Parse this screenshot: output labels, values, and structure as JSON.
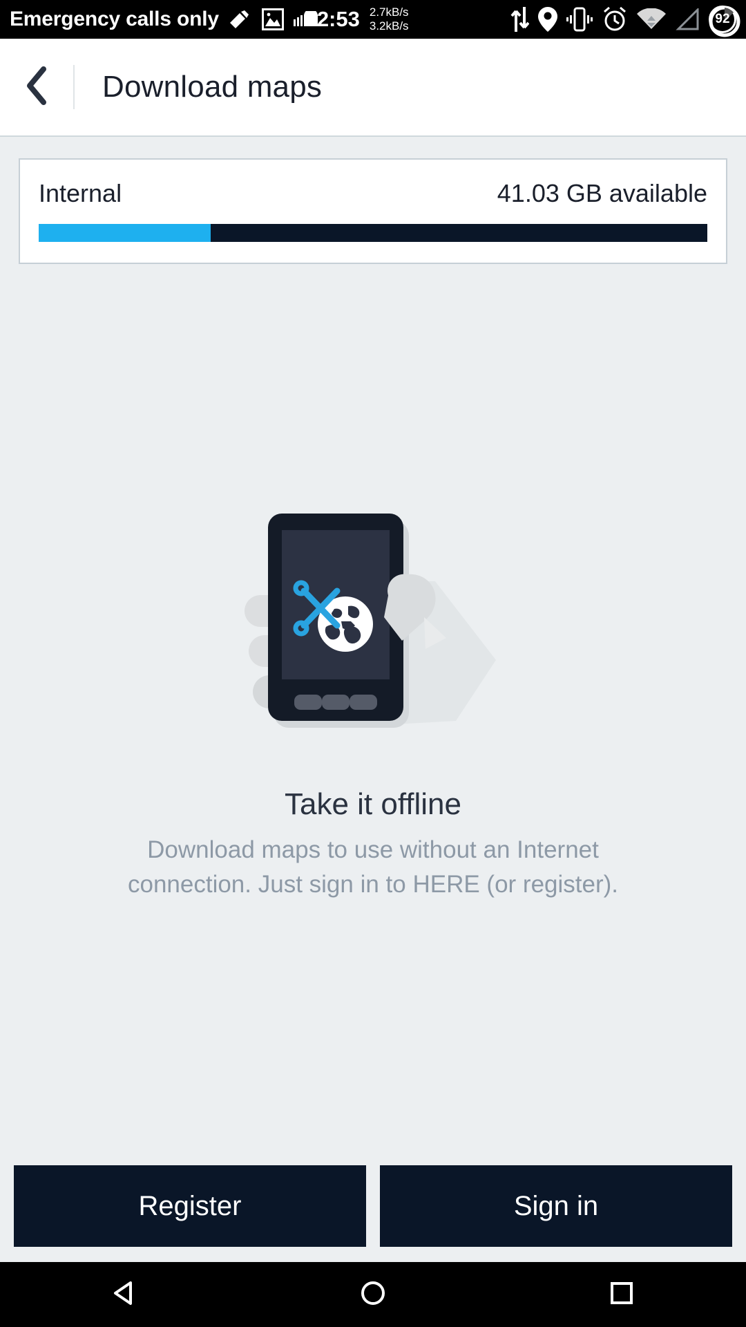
{
  "status_bar": {
    "carrier": "Emergency calls only",
    "clock": "2:53",
    "net_up": "2.7kB/s",
    "net_down": "3.2kB/s",
    "battery_level": "92",
    "icons": [
      "mute-icon",
      "screenshot-icon",
      "soundcloud-icon",
      "data-transfer-icon",
      "location-icon",
      "vibrate-icon",
      "alarm-icon",
      "wifi-icon",
      "signal-icon",
      "battery-icon"
    ]
  },
  "app_bar": {
    "back_icon": "chevron-left-icon",
    "title": "Download maps"
  },
  "storage": {
    "name": "Internal",
    "available": "41.03 GB available",
    "used_percent": 25.7,
    "fill_color": "#1eb0ef",
    "track_color": "#0a1628"
  },
  "empty_state": {
    "illustration": "hand-holding-phone-offline-maps-illustration",
    "title": "Take it offline",
    "body": "Download maps to use without an Internet connection. Just sign in to HERE (or register)."
  },
  "actions": {
    "register_label": "Register",
    "signin_label": "Sign in",
    "button_color": "#0a1628"
  },
  "nav_bar": {
    "back": "back-triangle-icon",
    "home": "home-circle-icon",
    "recents": "recents-square-icon"
  }
}
